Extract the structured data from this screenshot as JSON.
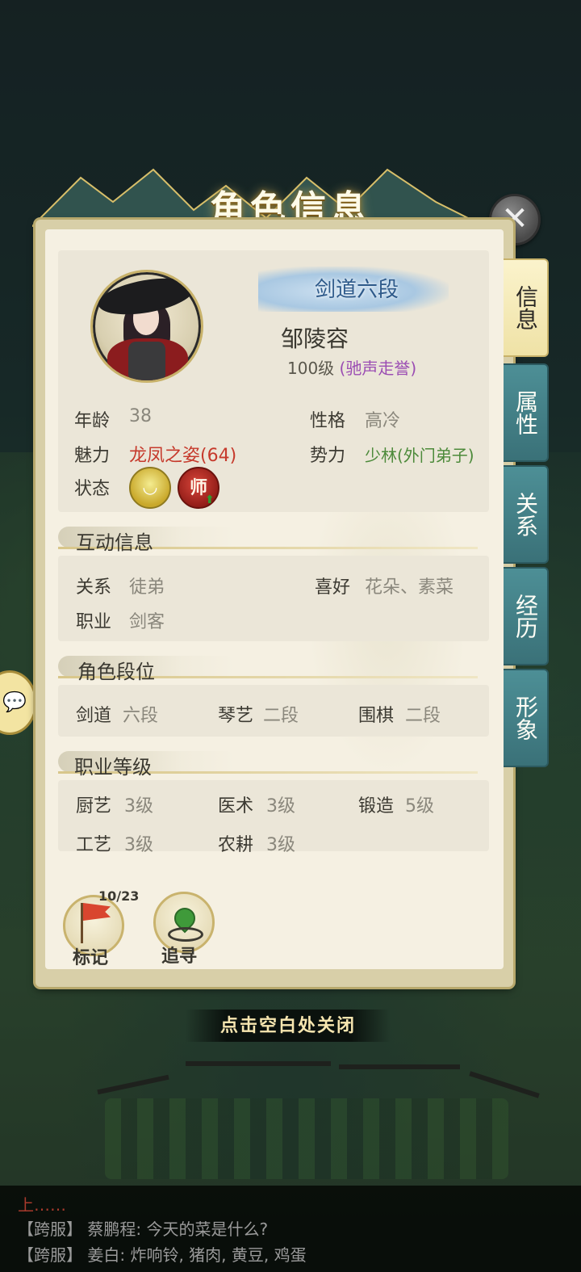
{
  "title": "角色信息",
  "close_hint": "点击空白处关闭",
  "tabs": [
    "信息",
    "属性",
    "关系",
    "经历",
    "形象"
  ],
  "active_tab": "信息",
  "character": {
    "rank": "剑道六段",
    "name": "邹陵容",
    "level": "100级",
    "reputation": "(驰声走誉)",
    "age_label": "年龄",
    "age": "38",
    "personality_label": "性格",
    "personality": "高冷",
    "charm_label": "魅力",
    "charm": "龙凤之姿(64)",
    "faction_label": "势力",
    "faction": "少林(外门弟子)",
    "status_label": "状态",
    "status_icons": [
      "bowl-icon",
      "master-icon"
    ],
    "status_master_glyph": "师"
  },
  "interaction": {
    "title": "互动信息",
    "relation_label": "关系",
    "relation": "徒弟",
    "hobby_label": "喜好",
    "hobby": "花朵、素菜",
    "job_label": "职业",
    "job": "剑客"
  },
  "ranks": {
    "title": "角色段位",
    "items": [
      {
        "label": "剑道",
        "value": "六段"
      },
      {
        "label": "琴艺",
        "value": "二段"
      },
      {
        "label": "围棋",
        "value": "二段"
      }
    ]
  },
  "job_levels": {
    "title": "职业等级",
    "items": [
      {
        "label": "厨艺",
        "value": "3级"
      },
      {
        "label": "医术",
        "value": "3级"
      },
      {
        "label": "锻造",
        "value": "5级"
      },
      {
        "label": "工艺",
        "value": "3级"
      },
      {
        "label": "农耕",
        "value": "3级"
      }
    ]
  },
  "actions": {
    "mark_label": "标记",
    "mark_count": "10/23",
    "track_label": "追寻"
  },
  "chat": {
    "top_line": "上……",
    "lines": [
      "【跨服】 蔡鹏程: 今天的菜是什么?",
      "【跨服】 姜白: 炸响铃, 猪肉, 黄豆, 鸡蛋"
    ]
  },
  "colors": {
    "tab_active": "#fbf3cc",
    "tab_inactive": "#4d8f96",
    "charm": "#c63a2c",
    "faction": "#4c8a3a",
    "reputation": "#9b4db3",
    "rank_text": "#2e5a8a"
  }
}
